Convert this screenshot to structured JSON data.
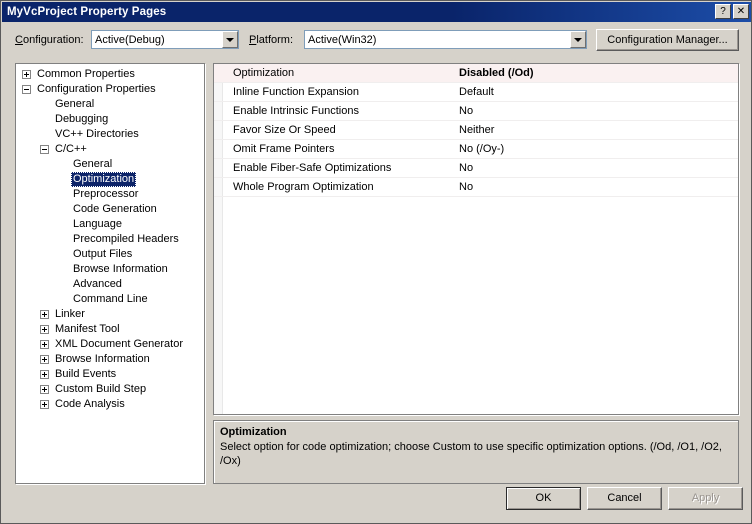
{
  "window": {
    "title": "MyVcProject Property Pages",
    "help_button": "?",
    "close_button": "✕"
  },
  "toolbar": {
    "configuration_label": "Configuration:",
    "configuration_value": "Active(Debug)",
    "platform_label": "Platform:",
    "platform_value": "Active(Win32)",
    "config_manager_label": "Configuration Manager..."
  },
  "tree": {
    "items": [
      {
        "label": "Common Properties",
        "indent": 0,
        "toggle": "plus",
        "selected": false
      },
      {
        "label": "Configuration Properties",
        "indent": 0,
        "toggle": "minus",
        "selected": false
      },
      {
        "label": "General",
        "indent": 1,
        "toggle": "none",
        "selected": false
      },
      {
        "label": "Debugging",
        "indent": 1,
        "toggle": "none",
        "selected": false
      },
      {
        "label": "VC++ Directories",
        "indent": 1,
        "toggle": "none",
        "selected": false
      },
      {
        "label": "C/C++",
        "indent": 1,
        "toggle": "minus",
        "selected": false
      },
      {
        "label": "General",
        "indent": 2,
        "toggle": "none",
        "selected": false
      },
      {
        "label": "Optimization",
        "indent": 2,
        "toggle": "none",
        "selected": true
      },
      {
        "label": "Preprocessor",
        "indent": 2,
        "toggle": "none",
        "selected": false
      },
      {
        "label": "Code Generation",
        "indent": 2,
        "toggle": "none",
        "selected": false
      },
      {
        "label": "Language",
        "indent": 2,
        "toggle": "none",
        "selected": false
      },
      {
        "label": "Precompiled Headers",
        "indent": 2,
        "toggle": "none",
        "selected": false
      },
      {
        "label": "Output Files",
        "indent": 2,
        "toggle": "none",
        "selected": false
      },
      {
        "label": "Browse Information",
        "indent": 2,
        "toggle": "none",
        "selected": false
      },
      {
        "label": "Advanced",
        "indent": 2,
        "toggle": "none",
        "selected": false
      },
      {
        "label": "Command Line",
        "indent": 2,
        "toggle": "none",
        "selected": false
      },
      {
        "label": "Linker",
        "indent": 1,
        "toggle": "plus",
        "selected": false
      },
      {
        "label": "Manifest Tool",
        "indent": 1,
        "toggle": "plus",
        "selected": false
      },
      {
        "label": "XML Document Generator",
        "indent": 1,
        "toggle": "plus",
        "selected": false
      },
      {
        "label": "Browse Information",
        "indent": 1,
        "toggle": "plus",
        "selected": false
      },
      {
        "label": "Build Events",
        "indent": 1,
        "toggle": "plus",
        "selected": false
      },
      {
        "label": "Custom Build Step",
        "indent": 1,
        "toggle": "plus",
        "selected": false
      },
      {
        "label": "Code Analysis",
        "indent": 1,
        "toggle": "plus",
        "selected": false
      }
    ]
  },
  "grid": {
    "rows": [
      {
        "name": "Optimization",
        "value": "Disabled (/Od)",
        "current": true
      },
      {
        "name": "Inline Function Expansion",
        "value": "Default",
        "current": false
      },
      {
        "name": "Enable Intrinsic Functions",
        "value": "No",
        "current": false
      },
      {
        "name": "Favor Size Or Speed",
        "value": "Neither",
        "current": false
      },
      {
        "name": "Omit Frame Pointers",
        "value": "No (/Oy-)",
        "current": false
      },
      {
        "name": "Enable Fiber-Safe Optimizations",
        "value": "No",
        "current": false
      },
      {
        "name": "Whole Program Optimization",
        "value": "No",
        "current": false
      }
    ]
  },
  "description": {
    "title": "Optimization",
    "text": "Select option for code optimization; choose Custom to use specific optimization options. (/Od, /O1, /O2, /Ox)"
  },
  "footer": {
    "ok_label": "OK",
    "cancel_label": "Cancel",
    "apply_label": "Apply"
  },
  "colors": {
    "titlebar": "#0a246a",
    "dialog_face": "#d6d2ca",
    "selection": "#0d2469",
    "current_row": "#faf1f1"
  }
}
